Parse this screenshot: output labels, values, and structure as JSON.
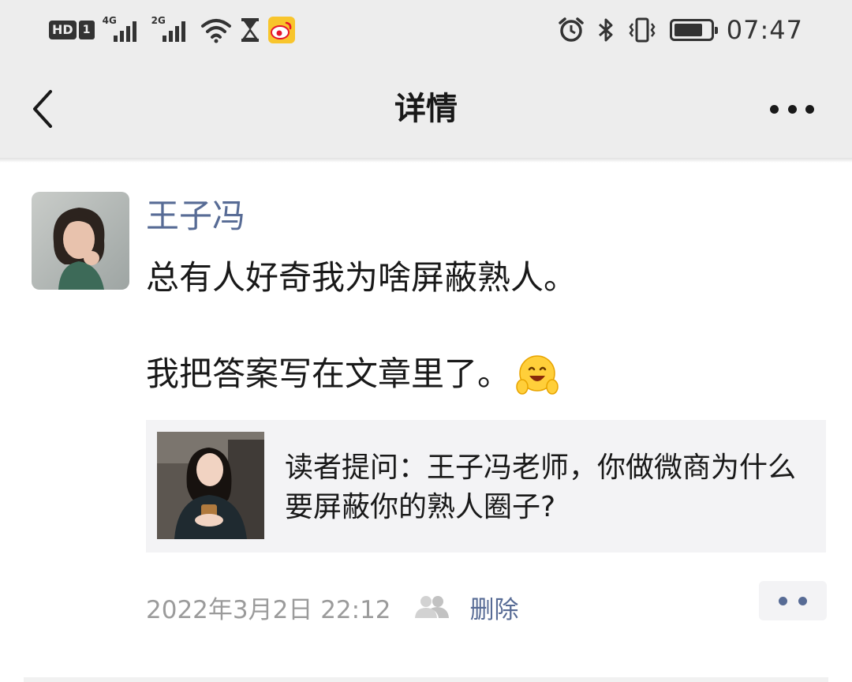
{
  "status_bar": {
    "hd_label": "HD",
    "sim_label": "1",
    "signal1_label": "4G",
    "signal2_label": "2G",
    "time": "07:47",
    "icons": [
      "wifi-icon",
      "hourglass-icon",
      "weibo-icon",
      "alarm-icon",
      "bluetooth-icon",
      "vibrate-icon",
      "battery-icon"
    ],
    "battery_level": 0.8
  },
  "nav": {
    "title": "详情",
    "back_icon": "chevron-left-icon",
    "more_icon": "more-dots-icon"
  },
  "post": {
    "author": "王子冯",
    "text_line1": "总有人好奇我为啥屏蔽熟人。",
    "text_line2": "我把答案写在文章里了。",
    "emoji": "happy-hands-emoji",
    "link_card": {
      "title": "读者提问：王子冯老师，你做微商为什么要屏蔽你的熟人圈子?"
    },
    "timestamp": "2022年3月2日 22:12",
    "visibility_icon": "group-icon",
    "delete_label": "删除",
    "comment_icon": "comment-dots-icon"
  },
  "colors": {
    "link_blue": "#576b95",
    "nav_bg": "#ededed",
    "card_bg": "#f3f3f5",
    "meta_gray": "#9b9b9b"
  }
}
